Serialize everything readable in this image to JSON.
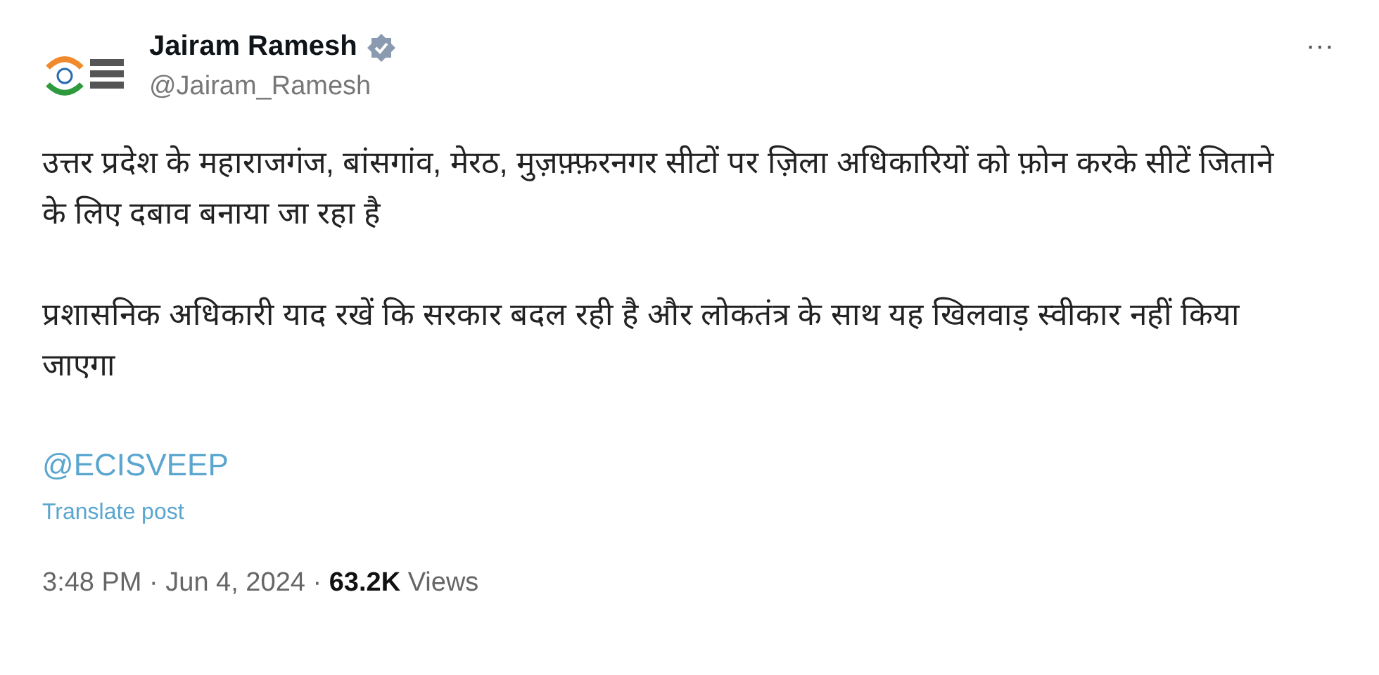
{
  "author": {
    "name": "Jairam Ramesh",
    "verified": true,
    "handle": "@Jairam_Ramesh"
  },
  "more_button": "···",
  "paragraphs": [
    "उत्तर प्रदेश के महाराजगंज, बांसगांव, मेरठ, मुज़फ़्फ़रनगर सीटों पर ज़िला अधिकारियों को फ़ोन करके सीटें जिताने के लिए दबाव बनाया जा रहा है",
    "प्रशासनिक अधिकारी याद रखें कि सरकार बदल रही है और लोकतंत्र के साथ यह खिलवाड़ स्वीकार नहीं किया जाएगा"
  ],
  "mention": "@ECISVEEP",
  "translate_link": "Translate post",
  "meta": "3:48 PM · Jun 4, 2024 · **63.2K** Views"
}
